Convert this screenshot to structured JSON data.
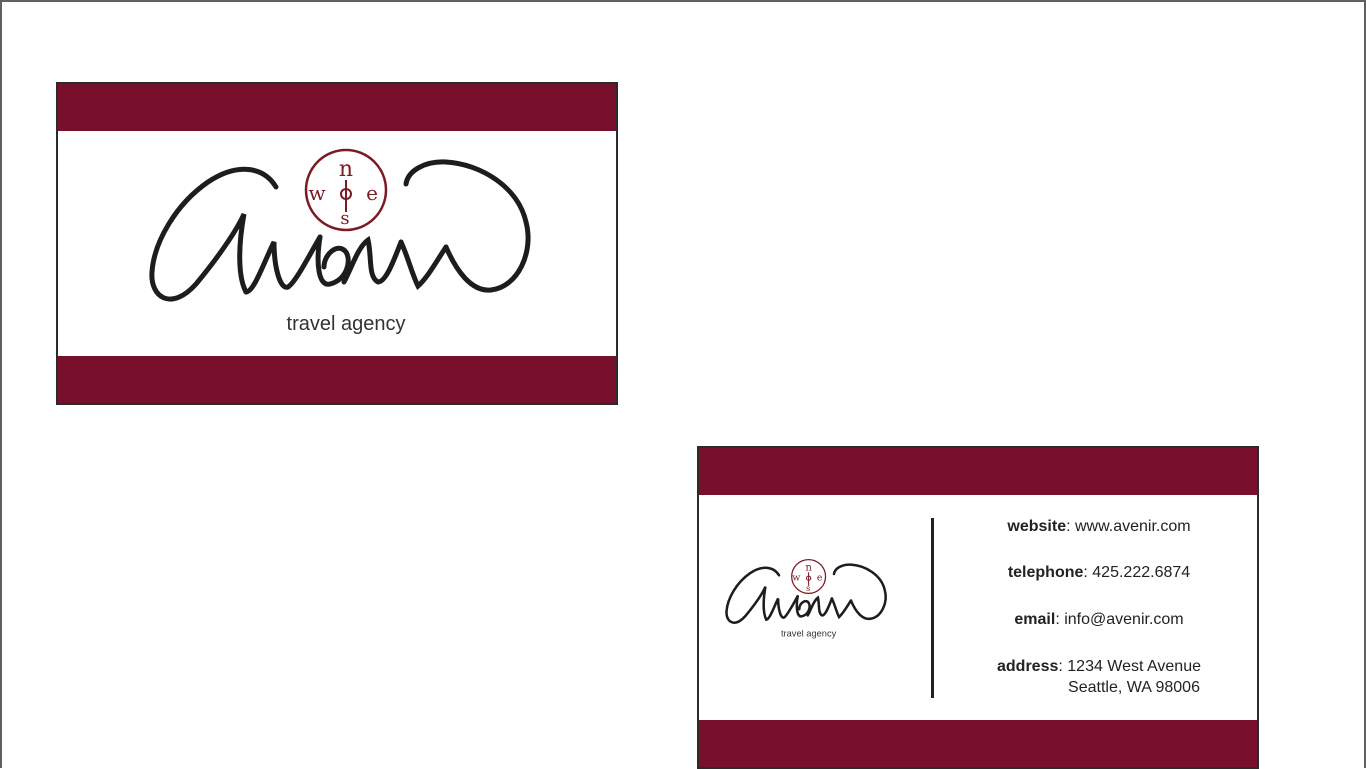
{
  "brand": {
    "name": "Avenir",
    "tagline": "travel agency",
    "compass": {
      "n": "n",
      "w": "w",
      "e": "e",
      "s": "s"
    },
    "colors": {
      "maroon": "#770f2d",
      "ink": "#1d1d1d",
      "compass": "#7a1a22"
    }
  },
  "contact": {
    "website_label": "website",
    "website_value": "www.avenir.com",
    "telephone_label": "telephone",
    "telephone_value": "425.222.6874",
    "email_label": "email",
    "email_value": "info@avenir.com",
    "address_label": "address",
    "address_line1": "1234 West Avenue",
    "address_line2": "Seattle, WA 98006"
  }
}
